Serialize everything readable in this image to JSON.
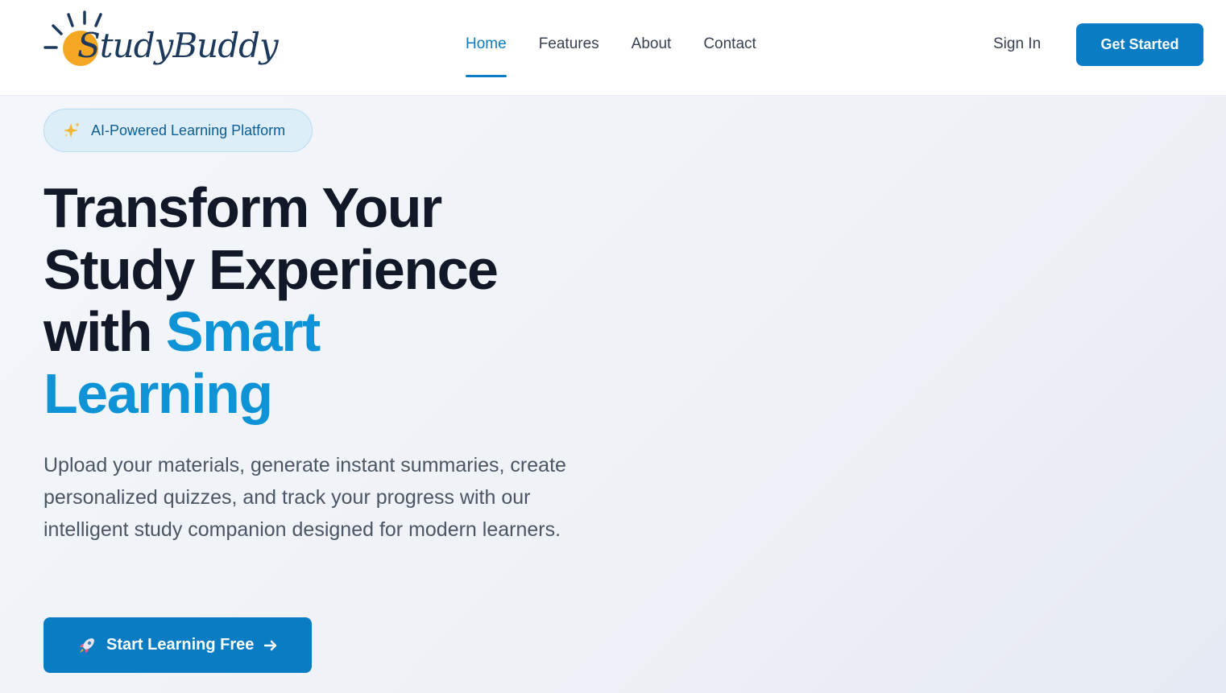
{
  "header": {
    "logo_text": "StudyBuddy",
    "nav": [
      {
        "label": "Home",
        "active": true
      },
      {
        "label": "Features",
        "active": false
      },
      {
        "label": "About",
        "active": false
      },
      {
        "label": "Contact",
        "active": false
      }
    ],
    "sign_in_label": "Sign In",
    "get_started_label": "Get Started"
  },
  "hero": {
    "badge_icon": "sparkles-icon",
    "badge_text": "AI-Powered Learning Platform",
    "headline_line1": "Transform Your",
    "headline_line2": "Study Experience",
    "headline_line3_plain": "with ",
    "headline_accent1": "Smart",
    "headline_accent2": "Learning",
    "subtext": "Upload your materials, generate instant summaries, create personalized quizzes, and track your progress with our intelligent study companion designed for modern learners.",
    "cta_label": "Start Learning Free",
    "cta_icon": "rocket-icon",
    "cta_trailing_icon": "arrow-right-icon"
  },
  "colors": {
    "primary": "#0a7cc4",
    "accent_text": "#0d93d6",
    "heading": "#111827",
    "body_text": "#4b5563",
    "logo_sun": "#f5a623"
  }
}
